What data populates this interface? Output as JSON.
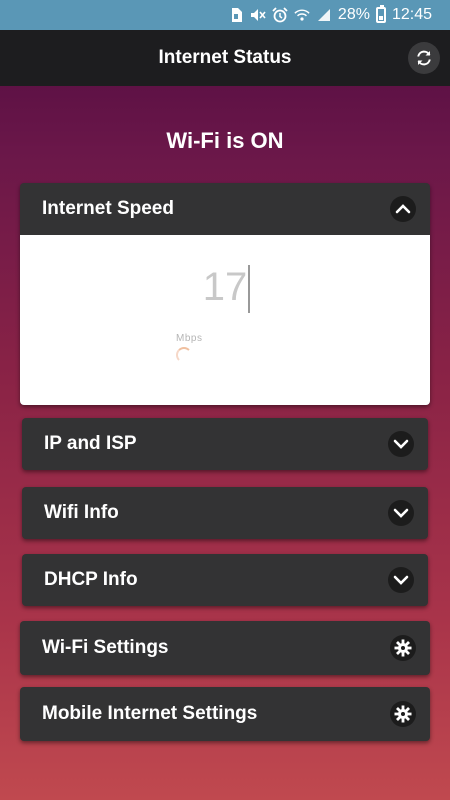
{
  "status_bar": {
    "battery_percent": "28%",
    "time": "12:45",
    "icons": [
      "sim-icon",
      "mute-icon",
      "alarm-icon",
      "wifi-icon",
      "signal-icon",
      "battery-icon"
    ]
  },
  "app_bar": {
    "title": "Internet Status",
    "refresh_icon": "refresh-icon"
  },
  "wifi_status": "Wi-Fi is ON",
  "speed_card": {
    "title": "Internet Speed",
    "value": "17",
    "unit": "Mbps",
    "expanded": true
  },
  "cards": [
    {
      "title": "IP and ISP",
      "icon": "chevron-down-icon"
    },
    {
      "title": "Wifi Info",
      "icon": "chevron-down-icon"
    },
    {
      "title": "DHCP Info",
      "icon": "chevron-down-icon"
    },
    {
      "title": "Wi-Fi Settings",
      "icon": "gear-icon"
    },
    {
      "title": "Mobile Internet Settings",
      "icon": "gear-icon"
    }
  ],
  "colors": {
    "status_bar": "#5a97b6",
    "app_bar": "#1d1d1f",
    "card": "#333334",
    "background_top": "#4f0a40",
    "background_bottom": "#c0494f"
  }
}
